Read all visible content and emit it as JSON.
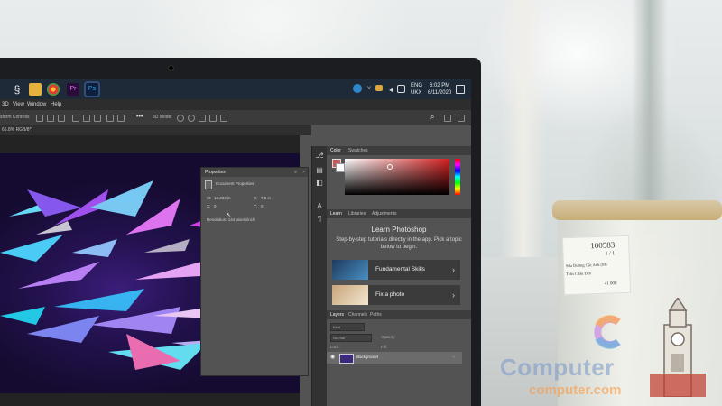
{
  "taskbar": {
    "clock_time": "6:02 PM",
    "clock_date": "6/11/2020",
    "lang_top": "ENG",
    "lang_bottom": "UKX"
  },
  "menubar": {
    "items": [
      "3D",
      "View",
      "Window",
      "Help"
    ]
  },
  "options_bar": {
    "transform_controls": "sform Controls",
    "mode_label": "3D Mode:"
  },
  "document_tab": {
    "label": "66.8% RGB/8*)"
  },
  "properties_panel": {
    "title": "Properties",
    "section": "Document Properties",
    "width_label": "W:",
    "width_value": "13.333 in",
    "height_label": "H:",
    "height_value": "7.5 in",
    "x_label": "X:",
    "x_value": "0",
    "y_label": "Y:",
    "y_value": "0",
    "resolution": "Resolution: 144 pixels/inch"
  },
  "color_panel": {
    "tabs": [
      "Color",
      "Swatches"
    ],
    "foreground_color": "#c85a5a",
    "background_color": "#ffffff"
  },
  "learn_panel": {
    "tabs": [
      "Learn",
      "Libraries",
      "Adjustments"
    ],
    "title": "Learn Photoshop",
    "description": "Step-by-step tutorials directly in the app. Pick a topic below to begin.",
    "cards": [
      {
        "label": "Fundamental Skills"
      },
      {
        "label": "Fix a photo"
      }
    ]
  },
  "layers_panel": {
    "tabs": [
      "Layers",
      "Channels",
      "Paths"
    ],
    "search_placeholder": "Kind",
    "blend_mode": "Normal",
    "opacity_label": "Opacity:",
    "lock_label": "Lock:",
    "fill_label": "Fill:",
    "layer_name": "Background"
  },
  "cup_label": {
    "line1": "100583",
    "line2": "1 / 1",
    "line3": "Sữa Dương Cắc Anh (M)",
    "line4": "Trân Châu Đen",
    "line5": "41 000"
  },
  "watermark": {
    "main": "Computer",
    "sub": "computer.com"
  }
}
